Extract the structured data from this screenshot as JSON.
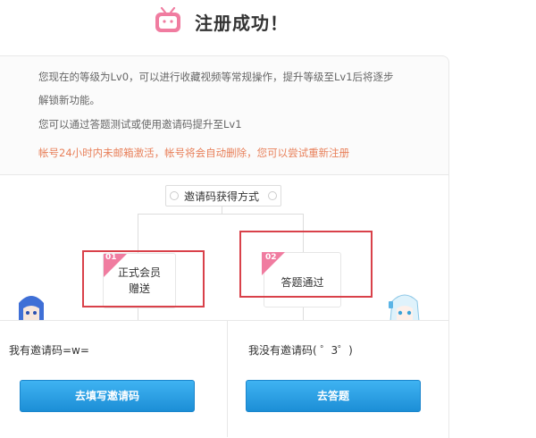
{
  "header": {
    "title": "注册成功！",
    "icon": "bilibili-tv-icon",
    "accent": "#f07ca0"
  },
  "info": {
    "line1": "您现在的等级为Lv0，可以进行收藏视频等常规操作，提升等级至Lv1后将逐步",
    "line2": "解锁新功能。",
    "line3": "您可以通过答题测试或使用邀请码提升至Lv1",
    "warning": "帐号24小时内未邮箱激活，帐号将会自动删除，您可以尝试重新注册",
    "warning_color": "#e8805a"
  },
  "flow": {
    "method_label": "邀请码获得方式",
    "options": [
      {
        "number": "01",
        "label_line1": "正式会员",
        "label_line2": "赠送"
      },
      {
        "number": "02",
        "label_line1": "答题通过",
        "label_line2": ""
      }
    ]
  },
  "bottom": {
    "left_label": "我有邀请码=w=",
    "left_button": "去填写邀请码",
    "right_label": "我没有邀请码( ゜3゜)",
    "right_button": "去答题",
    "button_color": "#2a9fe4"
  }
}
